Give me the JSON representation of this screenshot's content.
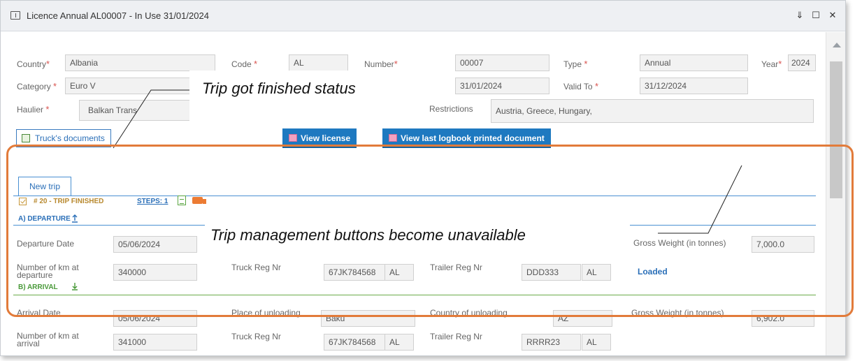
{
  "window": {
    "title": "Licence Annual AL00007 - In Use 31/01/2024",
    "pin_glyph": "⇓",
    "maximize_glyph": "☐",
    "close_glyph": "✕"
  },
  "licence": {
    "country_label": "Country",
    "country_value": "Albania",
    "code_label": "Code",
    "code_value": "AL",
    "number_label": "Number",
    "number_value": "00007",
    "type_label": "Type",
    "type_value": "Annual",
    "year_label": "Year",
    "year_value": "2024",
    "category_label": "Category",
    "category_value": "Euro V",
    "valid_from_value": "31/01/2024",
    "valid_to_label": "Valid To",
    "valid_to_value": "31/12/2024",
    "haulier_label": "Haulier",
    "haulier_value": "Balkan Trans",
    "restrictions_label": "Restrictions",
    "restrictions_value": "Austria,  Greece,  Hungary,",
    "required_mark": "*"
  },
  "buttons": {
    "trucks_documents": "Truck's documents",
    "view_license": "View license",
    "view_logbook": "View last logbook printed document"
  },
  "trip": {
    "tab_label": "New trip",
    "status": "# 20 - TRIP FINISHED",
    "steps_link": "STEPS: 1",
    "departure": {
      "section_title": "A) DEPARTURE",
      "date_label": "Departure Date",
      "date_value": "05/06/2024",
      "gross_weight_label": "Gross Weight (in tonnes)",
      "gross_weight_value": "7,000.0",
      "km_label": "Number of km at departure",
      "km_value": "340000",
      "truck_reg_label": "Truck Reg Nr",
      "truck_reg_value": "67JK784568",
      "truck_country": "AL",
      "trailer_reg_label": "Trailer Reg Nr",
      "trailer_reg_value": "DDD333",
      "trailer_country": "AL",
      "load_status": "Loaded"
    },
    "arrival": {
      "section_title": "B) ARRIVAL",
      "date_label": "Arrival Date",
      "date_value": "05/06/2024",
      "place_label": "Place of unloading",
      "place_value": "Baku",
      "country_label": "Country of unloading",
      "country_value": "AZ",
      "gross_weight_label": "Gross Weight (in tonnes)",
      "gross_weight_value": "6,902.0",
      "km_label": "Number of km at arrival",
      "km_value": "341000",
      "truck_reg_label": "Truck Reg Nr",
      "truck_reg_value": "67JK784568",
      "truck_country": "AL",
      "trailer_reg_label": "Trailer Reg Nr",
      "trailer_reg_value": "RRRR23",
      "trailer_country": "AL"
    }
  },
  "annotations": {
    "callout_1": "Trip got finished status",
    "callout_2": "Trip management buttons become unavailable",
    "frame_color": "#e27b3a"
  }
}
